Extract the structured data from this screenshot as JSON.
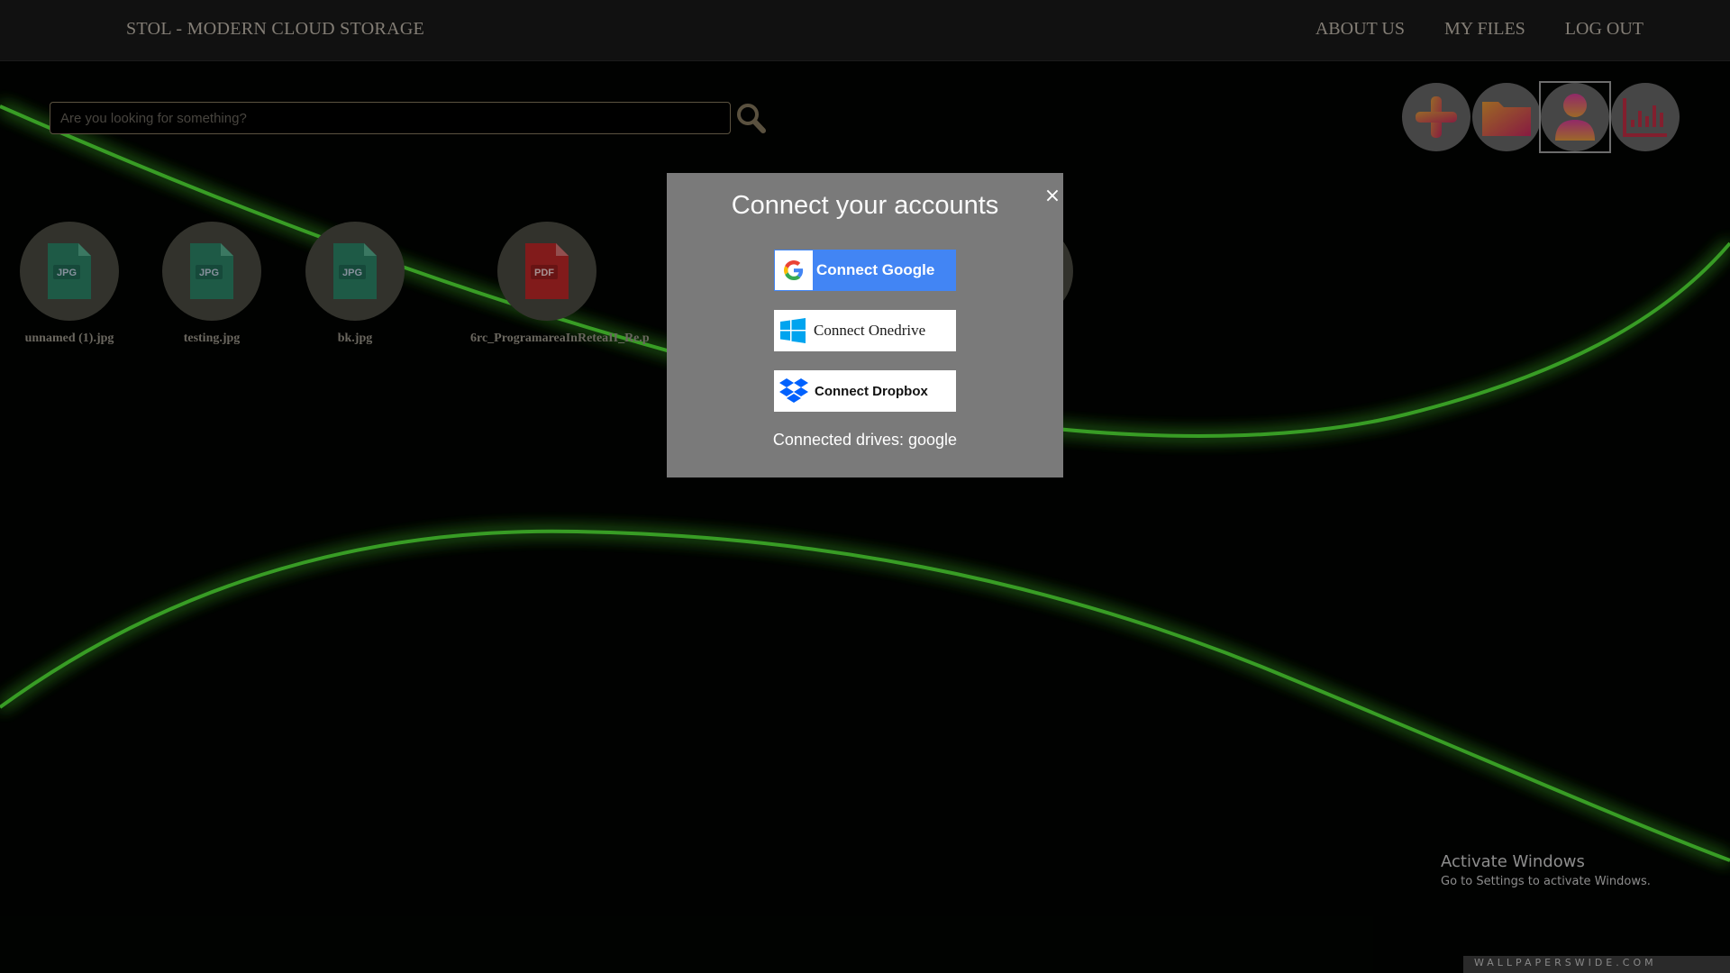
{
  "header": {
    "brand": "STOL - MODERN CLOUD STORAGE",
    "nav": [
      "ABOUT US",
      "MY FILES",
      "LOG OUT"
    ]
  },
  "search": {
    "placeholder": "Are you looking for something?",
    "value": ""
  },
  "actions": [
    {
      "name": "add",
      "icon": "plus-icon"
    },
    {
      "name": "folder",
      "icon": "folder-icon"
    },
    {
      "name": "account",
      "icon": "user-icon",
      "active": true
    },
    {
      "name": "stats",
      "icon": "bar-chart-icon"
    }
  ],
  "files": [
    {
      "name": "unnamed (1).jpg",
      "type": "JPG"
    },
    {
      "name": "testing.jpg",
      "type": "JPG"
    },
    {
      "name": "bk.jpg",
      "type": "JPG"
    },
    {
      "name": "6rc_ProgramareaInReteaII_Re.p",
      "type": "PDF"
    }
  ],
  "modal": {
    "title": "Connect your accounts",
    "close": "×",
    "buttons": {
      "google": "Connect Google",
      "onedrive": "Connect Onedrive",
      "dropbox": "Connect Dropbox"
    },
    "status": "Connected drives: google"
  },
  "watermark": {
    "title": "Activate Windows",
    "subtitle": "Go to Settings to activate Windows.",
    "wallpaper": "WALLPAPERSWIDE.COM"
  },
  "colors": {
    "google_blue": "#4285f4",
    "jpg_green": "#2e8a6c",
    "pdf_red": "#c62a2a",
    "accent_gradient_start": "#f0a030",
    "accent_gradient_end": "#d02060",
    "neon_green": "#4cff3a"
  }
}
